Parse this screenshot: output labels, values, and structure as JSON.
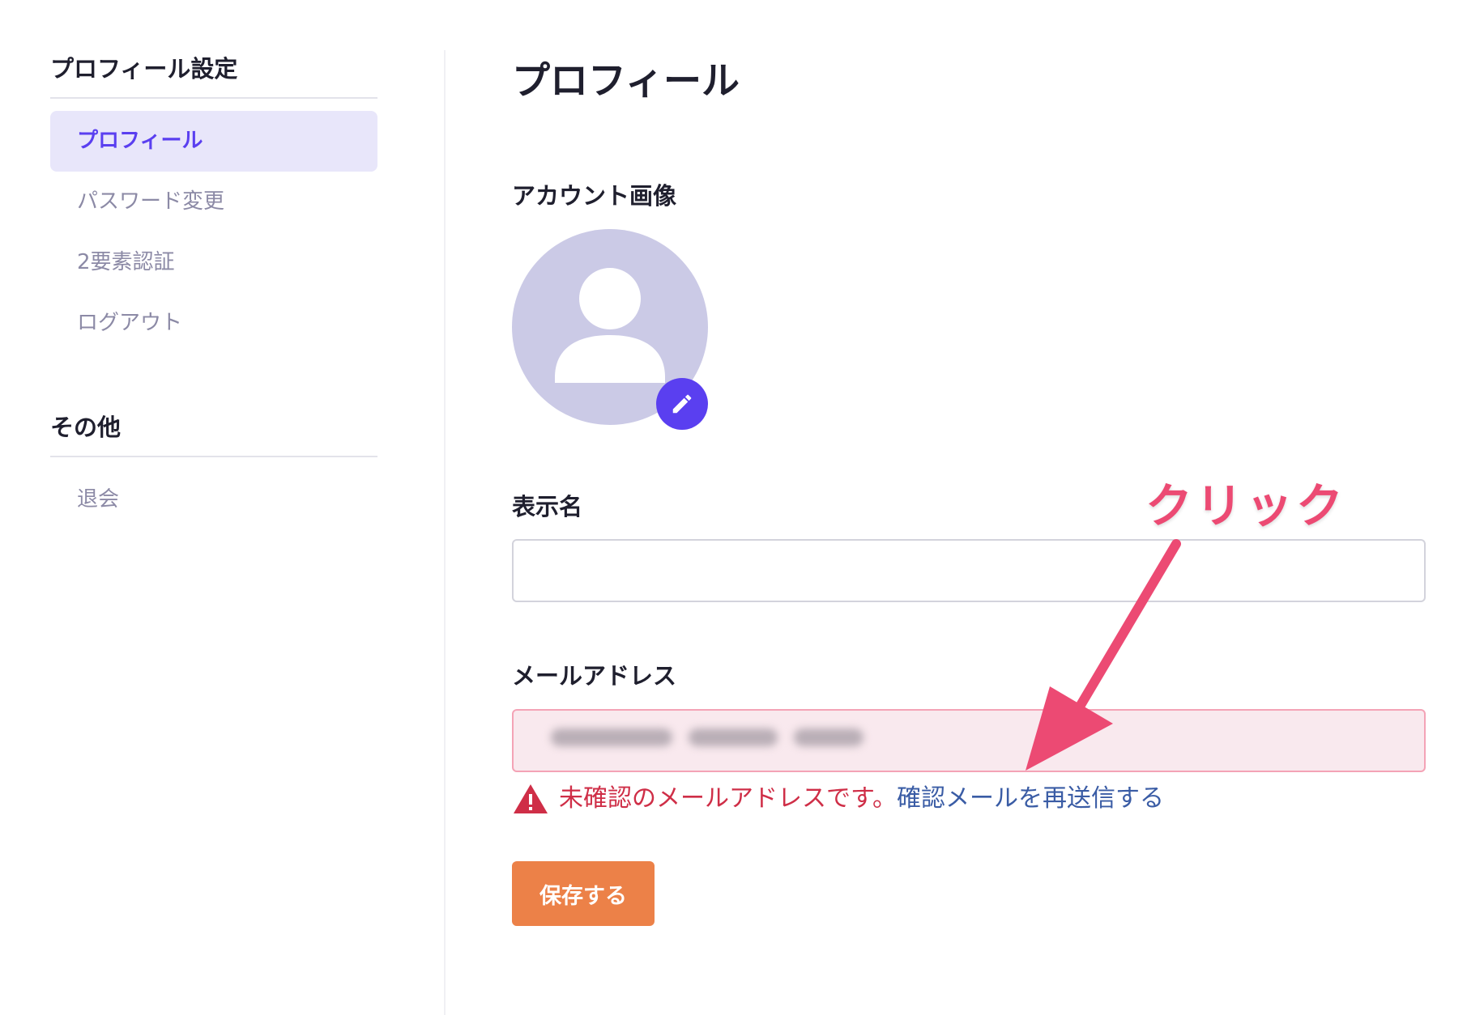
{
  "sidebar": {
    "section1_title": "プロフィール設定",
    "items": [
      {
        "label": "プロフィール"
      },
      {
        "label": "パスワード変更"
      },
      {
        "label": "2要素認証"
      },
      {
        "label": "ログアウト"
      }
    ],
    "section2_title": "その他",
    "other_items": [
      {
        "label": "退会"
      }
    ]
  },
  "main": {
    "title": "プロフィール",
    "avatar_label": "アカウント画像",
    "display_name_label": "表示名",
    "display_name_value": "",
    "email_label": "メールアドレス",
    "email_warning": "未確認のメールアドレスです。",
    "resend_link": "確認メールを再送信する",
    "save_button": "保存する"
  },
  "annotation": {
    "text": "クリック"
  },
  "colors": {
    "accent": "#5a3ff0",
    "active_bg": "#e8e6fa",
    "error": "#cf2e47",
    "link": "#3a5ca5",
    "save": "#ec8148",
    "annotation": "#ec4a73",
    "avatar_bg": "#cbcae6"
  }
}
